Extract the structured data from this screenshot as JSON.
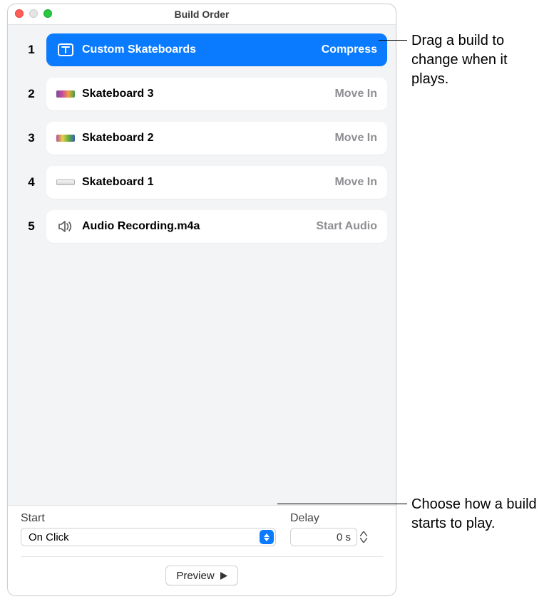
{
  "window": {
    "title": "Build Order"
  },
  "builds": [
    {
      "num": "1",
      "title": "Custom Skateboards",
      "effect": "Compress",
      "icon": "text",
      "selected": true
    },
    {
      "num": "2",
      "title": "Skateboard 3",
      "effect": "Move In",
      "icon": "thumb1",
      "selected": false
    },
    {
      "num": "3",
      "title": "Skateboard 2",
      "effect": "Move In",
      "icon": "thumb2",
      "selected": false
    },
    {
      "num": "4",
      "title": "Skateboard 1",
      "effect": "Move In",
      "icon": "thumb3",
      "selected": false
    },
    {
      "num": "5",
      "title": "Audio Recording.m4a",
      "effect": "Start Audio",
      "icon": "audio",
      "selected": false
    }
  ],
  "footer": {
    "start_label": "Start",
    "start_value": "On Click",
    "delay_label": "Delay",
    "delay_value": "0 s",
    "preview_label": "Preview"
  },
  "callouts": {
    "top": "Drag a build to change when it plays.",
    "bottom": "Choose how a build starts to play."
  },
  "thumbs": {
    "thumb1": "linear-gradient(90deg,#7a4a9a,#c84f9c,#f0a23c,#3ea04e)",
    "thumb2": "linear-gradient(90deg,#b94f94,#e7d04b,#5fae3d,#3a5fae)",
    "thumb3": "#e7e7ea"
  },
  "colors": {
    "accent": "#0a7bff",
    "muted": "#8e8e93"
  }
}
